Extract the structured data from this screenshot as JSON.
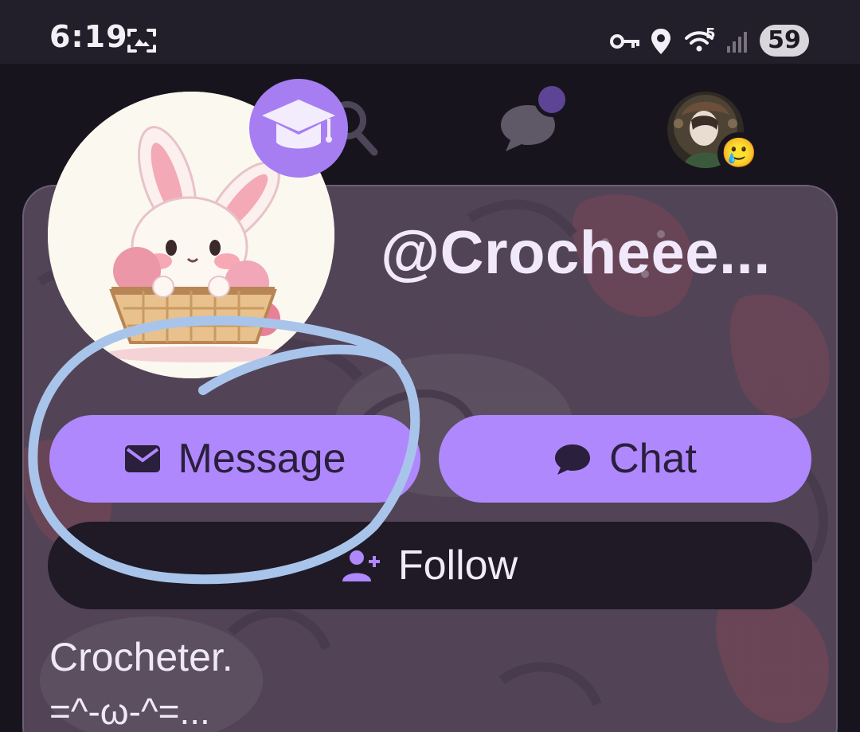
{
  "status_bar": {
    "time": "6:19",
    "wifi_badge": "5",
    "battery_level": "59",
    "icons": [
      "screenshot-icon",
      "vpn-key-icon",
      "location-icon",
      "wifi-icon",
      "signal-icon",
      "battery-icon"
    ]
  },
  "top_nav": {
    "icons": [
      "search-icon",
      "chat-bubble-icon",
      "notification-dot",
      "user-avatar"
    ],
    "avatar_badge_emoji": "🥲"
  },
  "profile": {
    "username": "@Crocheee...",
    "badge_icon": "graduation-cap-icon",
    "buttons": {
      "message_label": "Message",
      "chat_label": "Chat",
      "follow_label": "Follow"
    },
    "bio_line1": "Crocheter.",
    "bio_line2": "=^-ω-^=..."
  },
  "colors": {
    "accent": "#b088fd",
    "badge": "#a77ef2",
    "annotation": "#a9c4ea"
  }
}
